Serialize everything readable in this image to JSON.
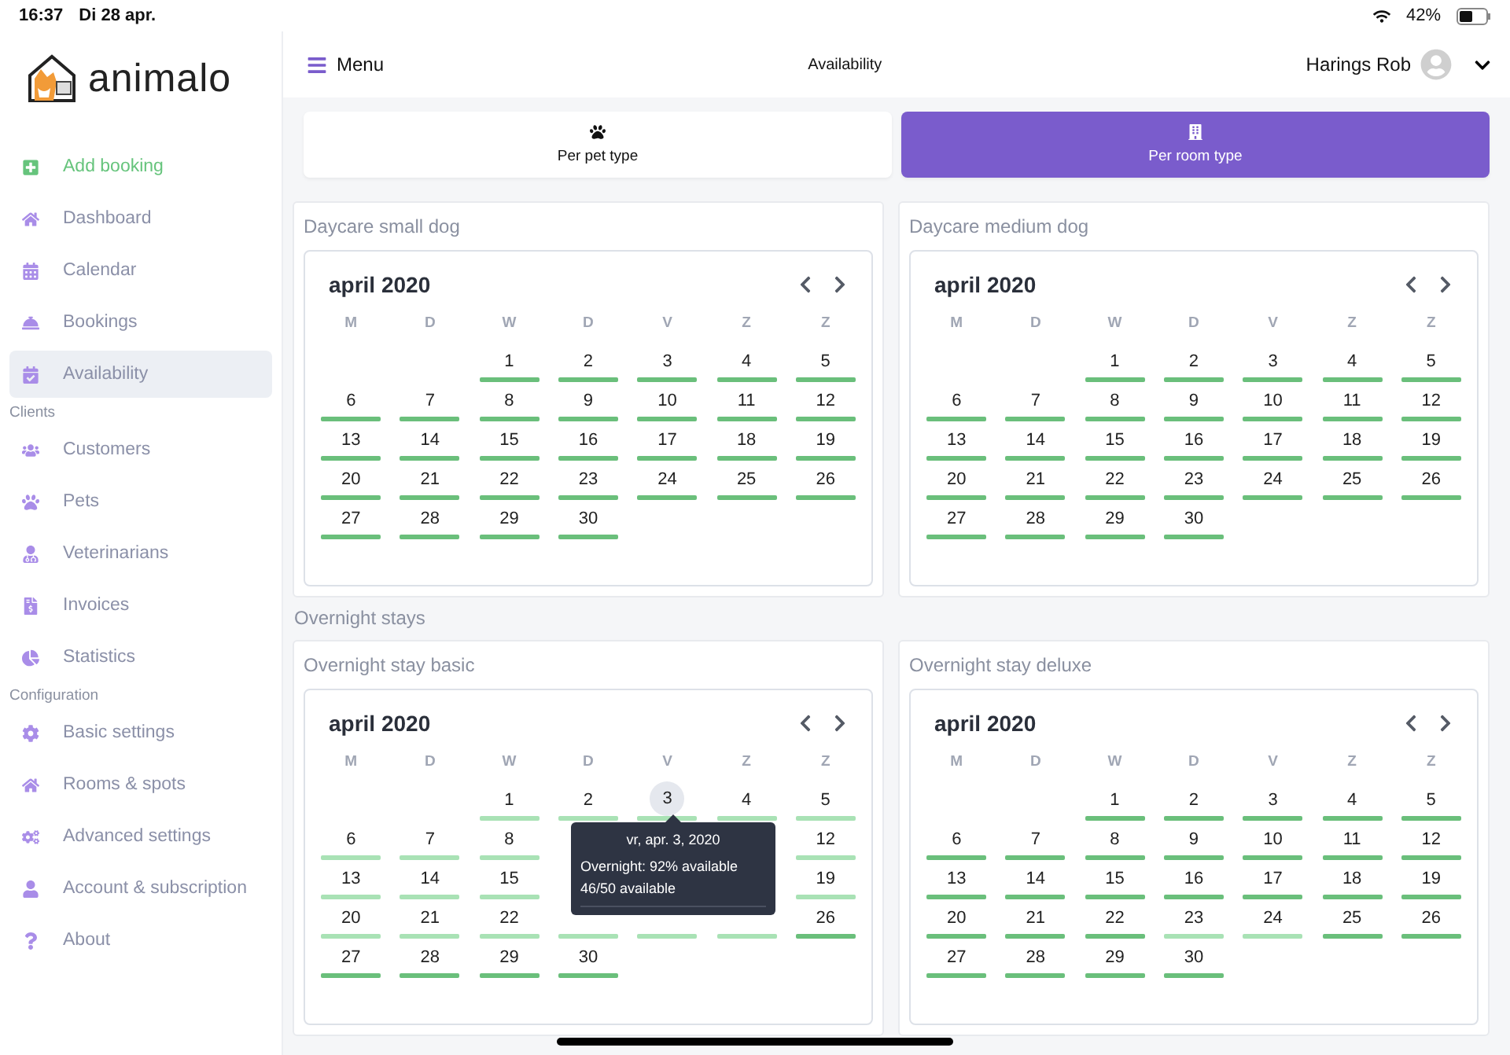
{
  "status_bar": {
    "time": "16:37",
    "date": "Di 28 apr.",
    "battery": "42%"
  },
  "sidebar": {
    "brand": "animalo",
    "sections": [
      {
        "items": [
          {
            "label": "Add booking",
            "kind": "action",
            "selected": false
          },
          {
            "label": "Dashboard",
            "kind": "link",
            "selected": false
          },
          {
            "label": "Calendar",
            "kind": "link",
            "selected": false
          },
          {
            "label": "Bookings",
            "kind": "link",
            "selected": false
          },
          {
            "label": "Availability",
            "kind": "link",
            "selected": true
          }
        ]
      },
      {
        "title": "Clients",
        "items": [
          {
            "label": "Customers",
            "kind": "link",
            "selected": false
          },
          {
            "label": "Pets",
            "kind": "link",
            "selected": false
          },
          {
            "label": "Veterinarians",
            "kind": "link",
            "selected": false
          },
          {
            "label": "Invoices",
            "kind": "link",
            "selected": false
          },
          {
            "label": "Statistics",
            "kind": "link",
            "selected": false
          }
        ]
      },
      {
        "title": "Configuration",
        "items": [
          {
            "label": "Basic settings",
            "kind": "link",
            "selected": false
          },
          {
            "label": "Rooms & spots",
            "kind": "link",
            "selected": false
          },
          {
            "label": "Advanced settings",
            "kind": "link",
            "selected": false
          },
          {
            "label": "Account & subscription",
            "kind": "link",
            "selected": false
          },
          {
            "label": "About",
            "kind": "link",
            "selected": false
          }
        ]
      }
    ]
  },
  "header": {
    "menu": "Menu",
    "title": "Availability",
    "user": "Harings Rob"
  },
  "tabs": [
    {
      "label": "Per pet type",
      "selected": false
    },
    {
      "label": "Per room type",
      "selected": true
    }
  ],
  "groups": [
    {
      "calendars": [
        {
          "title": "Daycare small dog",
          "month": "april 2020",
          "weekdays": [
            "M",
            "D",
            "W",
            "D",
            "V",
            "Z",
            "Z"
          ],
          "days": [
            {
              "kind": "blank"
            },
            {
              "kind": "blank"
            },
            {
              "kind": "day",
              "day": "1",
              "color": "#6abf7b"
            },
            {
              "kind": "day",
              "day": "2",
              "color": "#6abf7b"
            },
            {
              "kind": "day",
              "day": "3",
              "color": "#6abf7b"
            },
            {
              "kind": "day",
              "day": "4",
              "color": "#6abf7b"
            },
            {
              "kind": "day",
              "day": "5",
              "color": "#6abf7b"
            },
            {
              "kind": "day",
              "day": "6",
              "color": "#6abf7b"
            },
            {
              "kind": "day",
              "day": "7",
              "color": "#6abf7b"
            },
            {
              "kind": "day",
              "day": "8",
              "color": "#6abf7b"
            },
            {
              "kind": "day",
              "day": "9",
              "color": "#6abf7b"
            },
            {
              "kind": "day",
              "day": "10",
              "color": "#6abf7b"
            },
            {
              "kind": "day",
              "day": "11",
              "color": "#6abf7b"
            },
            {
              "kind": "day",
              "day": "12",
              "color": "#6abf7b"
            },
            {
              "kind": "day",
              "day": "13",
              "color": "#6abf7b"
            },
            {
              "kind": "day",
              "day": "14",
              "color": "#6abf7b"
            },
            {
              "kind": "day",
              "day": "15",
              "color": "#6abf7b"
            },
            {
              "kind": "day",
              "day": "16",
              "color": "#6abf7b"
            },
            {
              "kind": "day",
              "day": "17",
              "color": "#6abf7b"
            },
            {
              "kind": "day",
              "day": "18",
              "color": "#6abf7b"
            },
            {
              "kind": "day",
              "day": "19",
              "color": "#6abf7b"
            },
            {
              "kind": "day",
              "day": "20",
              "color": "#6abf7b"
            },
            {
              "kind": "day",
              "day": "21",
              "color": "#6abf7b"
            },
            {
              "kind": "day",
              "day": "22",
              "color": "#6abf7b"
            },
            {
              "kind": "day",
              "day": "23",
              "color": "#6abf7b"
            },
            {
              "kind": "day",
              "day": "24",
              "color": "#6abf7b"
            },
            {
              "kind": "day",
              "day": "25",
              "color": "#6abf7b"
            },
            {
              "kind": "day",
              "day": "26",
              "color": "#6abf7b"
            },
            {
              "kind": "day",
              "day": "27",
              "color": "#6abf7b"
            },
            {
              "kind": "day",
              "day": "28",
              "color": "#6abf7b"
            },
            {
              "kind": "day",
              "day": "29",
              "color": "#6abf7b"
            },
            {
              "kind": "day",
              "day": "30",
              "color": "#6abf7b"
            }
          ]
        },
        {
          "title": "Daycare medium dog",
          "month": "april 2020",
          "weekdays": [
            "M",
            "D",
            "W",
            "D",
            "V",
            "Z",
            "Z"
          ],
          "days": [
            {
              "kind": "blank"
            },
            {
              "kind": "blank"
            },
            {
              "kind": "day",
              "day": "1",
              "color": "#6abf7b"
            },
            {
              "kind": "day",
              "day": "2",
              "color": "#6abf7b"
            },
            {
              "kind": "day",
              "day": "3",
              "color": "#6abf7b"
            },
            {
              "kind": "day",
              "day": "4",
              "color": "#6abf7b"
            },
            {
              "kind": "day",
              "day": "5",
              "color": "#6abf7b"
            },
            {
              "kind": "day",
              "day": "6",
              "color": "#6abf7b"
            },
            {
              "kind": "day",
              "day": "7",
              "color": "#6abf7b"
            },
            {
              "kind": "day",
              "day": "8",
              "color": "#6abf7b"
            },
            {
              "kind": "day",
              "day": "9",
              "color": "#6abf7b"
            },
            {
              "kind": "day",
              "day": "10",
              "color": "#6abf7b"
            },
            {
              "kind": "day",
              "day": "11",
              "color": "#6abf7b"
            },
            {
              "kind": "day",
              "day": "12",
              "color": "#6abf7b"
            },
            {
              "kind": "day",
              "day": "13",
              "color": "#6abf7b"
            },
            {
              "kind": "day",
              "day": "14",
              "color": "#6abf7b"
            },
            {
              "kind": "day",
              "day": "15",
              "color": "#6abf7b"
            },
            {
              "kind": "day",
              "day": "16",
              "color": "#6abf7b"
            },
            {
              "kind": "day",
              "day": "17",
              "color": "#6abf7b"
            },
            {
              "kind": "day",
              "day": "18",
              "color": "#6abf7b"
            },
            {
              "kind": "day",
              "day": "19",
              "color": "#6abf7b"
            },
            {
              "kind": "day",
              "day": "20",
              "color": "#6abf7b"
            },
            {
              "kind": "day",
              "day": "21",
              "color": "#6abf7b"
            },
            {
              "kind": "day",
              "day": "22",
              "color": "#6abf7b"
            },
            {
              "kind": "day",
              "day": "23",
              "color": "#6abf7b"
            },
            {
              "kind": "day",
              "day": "24",
              "color": "#6abf7b"
            },
            {
              "kind": "day",
              "day": "25",
              "color": "#6abf7b"
            },
            {
              "kind": "day",
              "day": "26",
              "color": "#6abf7b"
            },
            {
              "kind": "day",
              "day": "27",
              "color": "#6abf7b"
            },
            {
              "kind": "day",
              "day": "28",
              "color": "#6abf7b"
            },
            {
              "kind": "day",
              "day": "29",
              "color": "#6abf7b"
            },
            {
              "kind": "day",
              "day": "30",
              "color": "#6abf7b"
            }
          ]
        }
      ]
    },
    {
      "title": "Overnight stays",
      "calendars": [
        {
          "title": "Overnight stay basic",
          "month": "april 2020",
          "weekdays": [
            "M",
            "D",
            "W",
            "D",
            "V",
            "Z",
            "Z"
          ],
          "tooltip": {
            "title": "vr, apr. 3, 2020",
            "lines": [
              "Overnight: 92% available",
              "46/50 available"
            ]
          },
          "days": [
            {
              "kind": "blank"
            },
            {
              "kind": "blank"
            },
            {
              "kind": "day",
              "day": "1",
              "color": "#a9e2b5",
              "highlighted": false
            },
            {
              "kind": "day",
              "day": "2",
              "color": "#a9e2b5",
              "highlighted": false
            },
            {
              "kind": "day",
              "day": "3",
              "color": "#a9e2b5",
              "highlighted": true
            },
            {
              "kind": "day",
              "day": "4",
              "color": "#a9e2b5",
              "highlighted": false
            },
            {
              "kind": "day",
              "day": "5",
              "color": "#a9e2b5",
              "highlighted": false
            },
            {
              "kind": "day",
              "day": "6",
              "color": "#a9e2b5",
              "highlighted": false
            },
            {
              "kind": "day",
              "day": "7",
              "color": "#a9e2b5",
              "highlighted": false
            },
            {
              "kind": "day",
              "day": "8",
              "color": "#a9e2b5",
              "highlighted": false
            },
            {
              "kind": "covered"
            },
            {
              "kind": "covered"
            },
            {
              "kind": "covered"
            },
            {
              "kind": "day",
              "day": "12",
              "color": "#a9e2b5",
              "highlighted": false
            },
            {
              "kind": "day",
              "day": "13",
              "color": "#a9e2b5",
              "highlighted": false
            },
            {
              "kind": "day",
              "day": "14",
              "color": "#a9e2b5",
              "highlighted": false
            },
            {
              "kind": "day",
              "day": "15",
              "color": "#a9e2b5",
              "highlighted": false
            },
            {
              "kind": "covered"
            },
            {
              "kind": "covered"
            },
            {
              "kind": "covered"
            },
            {
              "kind": "day",
              "day": "19",
              "color": "#a9e2b5",
              "highlighted": false
            },
            {
              "kind": "day",
              "day": "20",
              "color": "#a9e2b5",
              "highlighted": false
            },
            {
              "kind": "day",
              "day": "21",
              "color": "#a9e2b5",
              "highlighted": false
            },
            {
              "kind": "day",
              "day": "22",
              "color": "#a9e2b5",
              "highlighted": false
            },
            {
              "kind": "bar",
              "color": "#a9e2b5"
            },
            {
              "kind": "bar",
              "color": "#a9e2b5"
            },
            {
              "kind": "bar",
              "color": "#a9e2b5"
            },
            {
              "kind": "day",
              "day": "26",
              "color": "#6abf7b",
              "highlighted": false
            },
            {
              "kind": "day",
              "day": "27",
              "color": "#6abf7b",
              "highlighted": false
            },
            {
              "kind": "day",
              "day": "28",
              "color": "#6abf7b",
              "highlighted": false
            },
            {
              "kind": "day",
              "day": "29",
              "color": "#6abf7b",
              "highlighted": false
            },
            {
              "kind": "day",
              "day": "30",
              "color": "#6abf7b",
              "highlighted": false
            }
          ]
        },
        {
          "title": "Overnight stay deluxe",
          "month": "april 2020",
          "weekdays": [
            "M",
            "D",
            "W",
            "D",
            "V",
            "Z",
            "Z"
          ],
          "days": [
            {
              "kind": "blank"
            },
            {
              "kind": "blank"
            },
            {
              "kind": "day",
              "day": "1",
              "color": "#6abf7b"
            },
            {
              "kind": "day",
              "day": "2",
              "color": "#6abf7b"
            },
            {
              "kind": "day",
              "day": "3",
              "color": "#6abf7b"
            },
            {
              "kind": "day",
              "day": "4",
              "color": "#6abf7b"
            },
            {
              "kind": "day",
              "day": "5",
              "color": "#6abf7b"
            },
            {
              "kind": "day",
              "day": "6",
              "color": "#6abf7b"
            },
            {
              "kind": "day",
              "day": "7",
              "color": "#6abf7b"
            },
            {
              "kind": "day",
              "day": "8",
              "color": "#6abf7b"
            },
            {
              "kind": "day",
              "day": "9",
              "color": "#6abf7b"
            },
            {
              "kind": "day",
              "day": "10",
              "color": "#6abf7b"
            },
            {
              "kind": "day",
              "day": "11",
              "color": "#6abf7b"
            },
            {
              "kind": "day",
              "day": "12",
              "color": "#6abf7b"
            },
            {
              "kind": "day",
              "day": "13",
              "color": "#6abf7b"
            },
            {
              "kind": "day",
              "day": "14",
              "color": "#6abf7b"
            },
            {
              "kind": "day",
              "day": "15",
              "color": "#6abf7b"
            },
            {
              "kind": "day",
              "day": "16",
              "color": "#6abf7b"
            },
            {
              "kind": "day",
              "day": "17",
              "color": "#6abf7b"
            },
            {
              "kind": "day",
              "day": "18",
              "color": "#6abf7b"
            },
            {
              "kind": "day",
              "day": "19",
              "color": "#6abf7b"
            },
            {
              "kind": "day",
              "day": "20",
              "color": "#6abf7b"
            },
            {
              "kind": "day",
              "day": "21",
              "color": "#6abf7b"
            },
            {
              "kind": "day",
              "day": "22",
              "color": "#6abf7b"
            },
            {
              "kind": "day",
              "day": "23",
              "color": "#a9e2b5"
            },
            {
              "kind": "day",
              "day": "24",
              "color": "#a9e2b5"
            },
            {
              "kind": "day",
              "day": "25",
              "color": "#6abf7b"
            },
            {
              "kind": "day",
              "day": "26",
              "color": "#6abf7b"
            },
            {
              "kind": "day",
              "day": "27",
              "color": "#6abf7b"
            },
            {
              "kind": "day",
              "day": "28",
              "color": "#6abf7b"
            },
            {
              "kind": "day",
              "day": "29",
              "color": "#6abf7b"
            },
            {
              "kind": "day",
              "day": "30",
              "color": "#6abf7b"
            }
          ]
        }
      ]
    }
  ]
}
